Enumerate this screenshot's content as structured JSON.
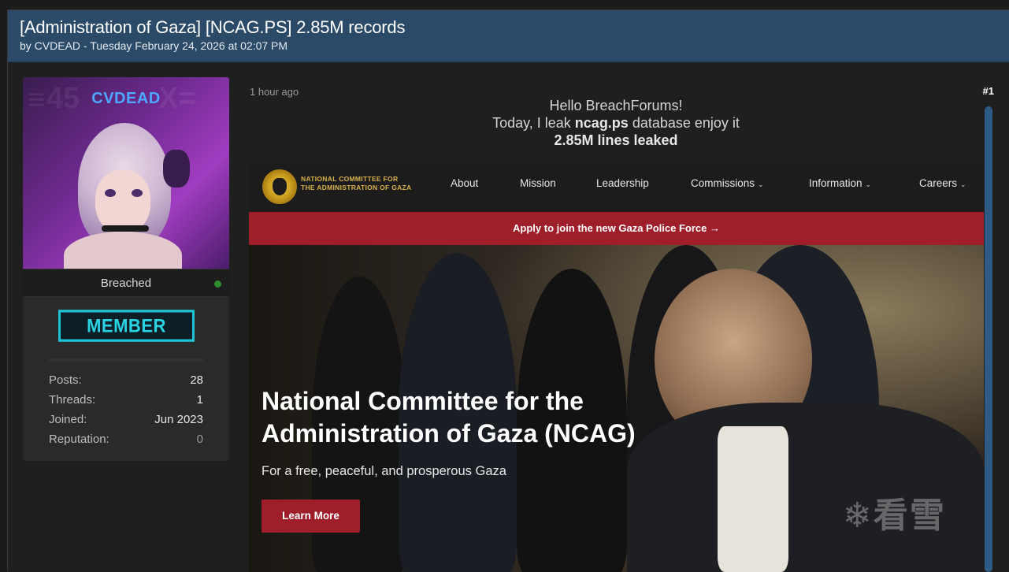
{
  "thread": {
    "title": "[Administration of Gaza] [NCAG.PS] 2.85M records",
    "meta": "by CVDEAD - Tuesday February 24, 2026 at 02:07 PM"
  },
  "user": {
    "avatar_text": "CVDEAD",
    "status": "Breached",
    "rank": "MEMBER",
    "stats": [
      {
        "label": "Posts:",
        "value": "28"
      },
      {
        "label": "Threads:",
        "value": "1"
      },
      {
        "label": "Joined:",
        "value": "Jun 2023"
      },
      {
        "label": "Reputation:",
        "value": "0"
      }
    ]
  },
  "post": {
    "time": "1 hour ago",
    "number": "#1",
    "line1": "Hello BreachForums!",
    "line2_prefix": "Today, I leak ",
    "line2_bold": "ncag.ps",
    "line2_suffix": " database enjoy it",
    "line3": "2.85M lines leaked"
  },
  "embed": {
    "logo_line1": "NATIONAL COMMITTEE FOR",
    "logo_line2": "THE ADMINISTRATION OF GAZA",
    "nav": [
      "About",
      "Mission",
      "Leadership",
      "Commissions",
      "Information",
      "Careers"
    ],
    "promo": "Apply to join the new Gaza Police Force →",
    "hero_title_1": "National Committee for the",
    "hero_title_2": "Administration of Gaza (NCAG)",
    "hero_subtitle": "For a free, peaceful, and prosperous Gaza",
    "cta": "Learn More"
  },
  "watermark": "❄看雪",
  "colors": {
    "header_bg": "#2a4a68",
    "rank_accent": "#1fc3d4",
    "brand_red": "#9e1f2a",
    "online": "#2e8f2e"
  }
}
